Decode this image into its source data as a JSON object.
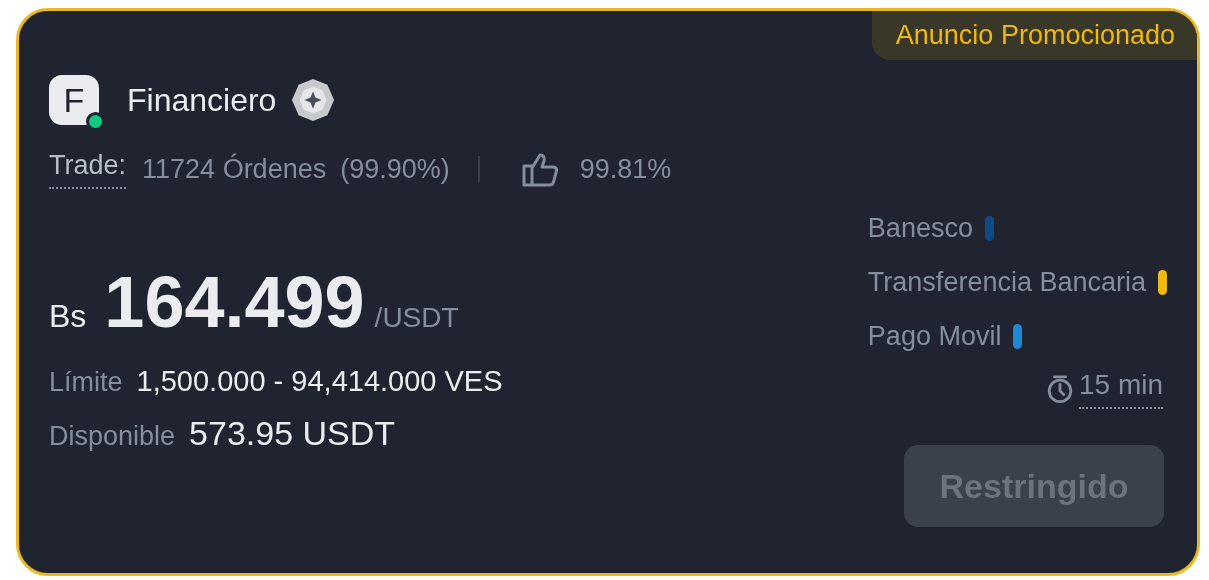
{
  "promo_badge": "Anuncio Promocionado",
  "advertiser": {
    "initial": "F",
    "name": "Financiero",
    "online": true
  },
  "stats": {
    "trade_label": "Trade:",
    "orders": "11724 Órdenes",
    "completion": "(99.90%)",
    "rating": "99.81%"
  },
  "price": {
    "currency": "Bs",
    "amount": "164.499",
    "unit": "/USDT"
  },
  "limit": {
    "label": "Límite",
    "value": "1,500.000 - 94,414.000 VES"
  },
  "available": {
    "label": "Disponible",
    "value": "573.95 USDT"
  },
  "payment_methods": [
    {
      "name": "Banesco",
      "color": "#0e4a86"
    },
    {
      "name": "Transferencia Bancaria",
      "color": "#f0b90b"
    },
    {
      "name": "Pago Movil",
      "color": "#1e88d0"
    }
  ],
  "time_limit": "15 min",
  "action_button": {
    "label": "Restringido",
    "disabled": true
  }
}
